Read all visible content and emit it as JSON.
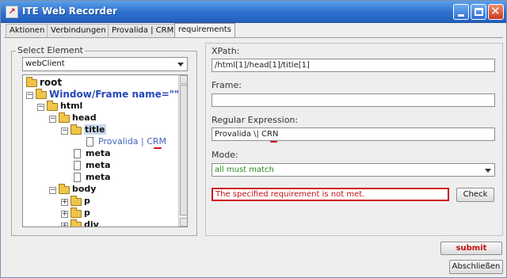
{
  "window": {
    "title": "ITE Web Recorder",
    "controls": {
      "minimize": "minimize",
      "maximize": "maximize",
      "close": "close"
    }
  },
  "tabs": [
    {
      "label": "Aktionen"
    },
    {
      "label": "Verbindungen"
    },
    {
      "label": "Provalida | CRM"
    },
    {
      "label": "requirements",
      "active": true
    }
  ],
  "left_panel": {
    "title": "Select Element",
    "client_select": {
      "value": "webClient"
    },
    "tree": [
      {
        "label": "root",
        "type": "folder"
      },
      {
        "label": "Window/Frame name=\"\"",
        "type": "folder"
      },
      {
        "label": "html",
        "type": "folder"
      },
      {
        "label": "head",
        "type": "folder"
      },
      {
        "label": "title",
        "type": "folder",
        "selected": true
      },
      {
        "label": "Provalida | CRM",
        "type": "text"
      },
      {
        "label": "meta",
        "type": "doc"
      },
      {
        "label": "meta",
        "type": "doc"
      },
      {
        "label": "meta",
        "type": "doc"
      },
      {
        "label": "body",
        "type": "folder"
      },
      {
        "label": "p",
        "type": "folder"
      },
      {
        "label": "p",
        "type": "folder"
      },
      {
        "label": "div",
        "type": "folder"
      }
    ]
  },
  "right_panel": {
    "xpath": {
      "label": "XPath:",
      "value": "/html[1]/head[1]/title[1]"
    },
    "frame": {
      "label": "Frame:",
      "value": ""
    },
    "regex": {
      "label": "Regular Expression:",
      "value": "Provalida \\| CRN"
    },
    "mode": {
      "label": "Mode:",
      "value": "all must match"
    },
    "error": "The specified requirement is not met.",
    "check_button": "Check"
  },
  "footer": {
    "submit_button": "submit",
    "close_button": "Abschließen"
  },
  "colors": {
    "titlebar": "#2d6fcf",
    "error_red": "#c41010",
    "mode_green": "#2b8a1f",
    "tree_blue": "#2448b8"
  }
}
